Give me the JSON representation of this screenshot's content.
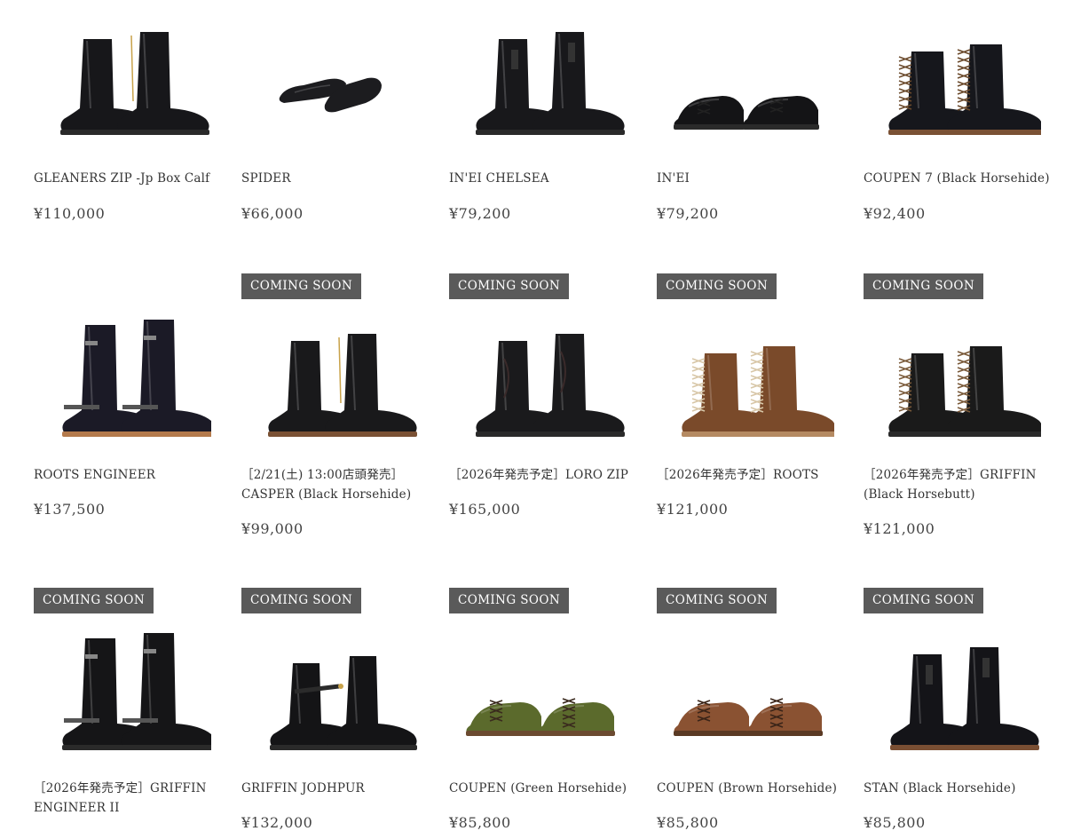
{
  "products": [
    {
      "name_lines": [
        "GLEANERS ZIP -Jp Box Calf"
      ],
      "price": "¥110,000",
      "badge": "",
      "shoe": {
        "style": "zip-boot",
        "leather": "#17171a",
        "sole": "#2a2a2a",
        "laces": ""
      }
    },
    {
      "name_lines": [
        "SPIDER"
      ],
      "price": "¥66,000",
      "badge": "",
      "shoe": {
        "style": "slipper",
        "leather": "#1c1c1f",
        "sole": "#2a2a2a",
        "laces": ""
      }
    },
    {
      "name_lines": [
        "IN'EI CHELSEA"
      ],
      "price": "¥79,200",
      "badge": "",
      "shoe": {
        "style": "chelsea",
        "leather": "#18181b",
        "sole": "#2a2a2a",
        "laces": ""
      }
    },
    {
      "name_lines": [
        "IN'EI"
      ],
      "price": "¥79,200",
      "badge": "",
      "shoe": {
        "style": "oxford",
        "leather": "#141416",
        "sole": "#2a2a2a",
        "laces": "#222"
      }
    },
    {
      "name_lines": [
        "COUPEN 7 (Black Horsehide)"
      ],
      "price": "¥92,400",
      "badge": "",
      "shoe": {
        "style": "lace-boot",
        "leather": "#16171c",
        "sole": "#7a5134",
        "laces": "#6b4a2c"
      }
    },
    {
      "name_lines": [
        "ROOTS ENGINEER"
      ],
      "price": "¥137,500",
      "badge": "",
      "shoe": {
        "style": "engineer",
        "leather": "#1b1a26",
        "sole": "#b47a4c",
        "laces": ""
      }
    },
    {
      "name_lines": [
        "［2/21(土) 13:00店頭発売］",
        "CASPER (Black Horsehide)"
      ],
      "price": "¥99,000",
      "badge": "COMING SOON",
      "shoe": {
        "style": "zip-boot",
        "leather": "#19191b",
        "sole": "#7a5134",
        "laces": ""
      }
    },
    {
      "name_lines": [
        "［2026年発売予定］LORO ZIP"
      ],
      "price": "¥165,000",
      "badge": "COMING SOON",
      "shoe": {
        "style": "western",
        "leather": "#1a1a1c",
        "sole": "#2a2a2a",
        "laces": ""
      }
    },
    {
      "name_lines": [
        "［2026年発売予定］ROOTS"
      ],
      "price": "¥121,000",
      "badge": "COMING SOON",
      "shoe": {
        "style": "lace-boot",
        "leather": "#7a4a2a",
        "sole": "#b58a62",
        "laces": "#d8c7a8"
      }
    },
    {
      "name_lines": [
        "［2026年発売予定］GRIFFIN",
        "(Black Horsebutt)"
      ],
      "price": "¥121,000",
      "badge": "COMING SOON",
      "shoe": {
        "style": "lace-boot",
        "leather": "#1a1a1a",
        "sole": "#2a2a2a",
        "laces": "#7a5a3a"
      }
    },
    {
      "name_lines": [
        "［2026年発売予定］GRIFFIN",
        "ENGINEER II"
      ],
      "price": "",
      "badge": "COMING SOON",
      "shoe": {
        "style": "engineer",
        "leather": "#151517",
        "sole": "#2a2a2a",
        "laces": ""
      }
    },
    {
      "name_lines": [
        "GRIFFIN JODHPUR"
      ],
      "price": "¥132,000",
      "badge": "COMING SOON",
      "shoe": {
        "style": "jodhpur",
        "leather": "#141416",
        "sole": "#2a2a2a",
        "laces": ""
      }
    },
    {
      "name_lines": [
        "COUPEN (Green Horsehide)"
      ],
      "price": "¥85,800",
      "badge": "COMING SOON",
      "shoe": {
        "style": "chukka",
        "leather": "#5b6a2c",
        "sole": "#6b4a30",
        "laces": "#3a2a1e"
      }
    },
    {
      "name_lines": [
        "COUPEN (Brown Horsehide)"
      ],
      "price": "¥85,800",
      "badge": "COMING SOON",
      "shoe": {
        "style": "chukka",
        "leather": "#8a5232",
        "sole": "#5a3a24",
        "laces": "#3a2418"
      }
    },
    {
      "name_lines": [
        "STAN (Black Horsehide)"
      ],
      "price": "¥85,800",
      "badge": "COMING SOON",
      "shoe": {
        "style": "chelsea",
        "leather": "#141418",
        "sole": "#7a4f33",
        "laces": ""
      }
    }
  ]
}
